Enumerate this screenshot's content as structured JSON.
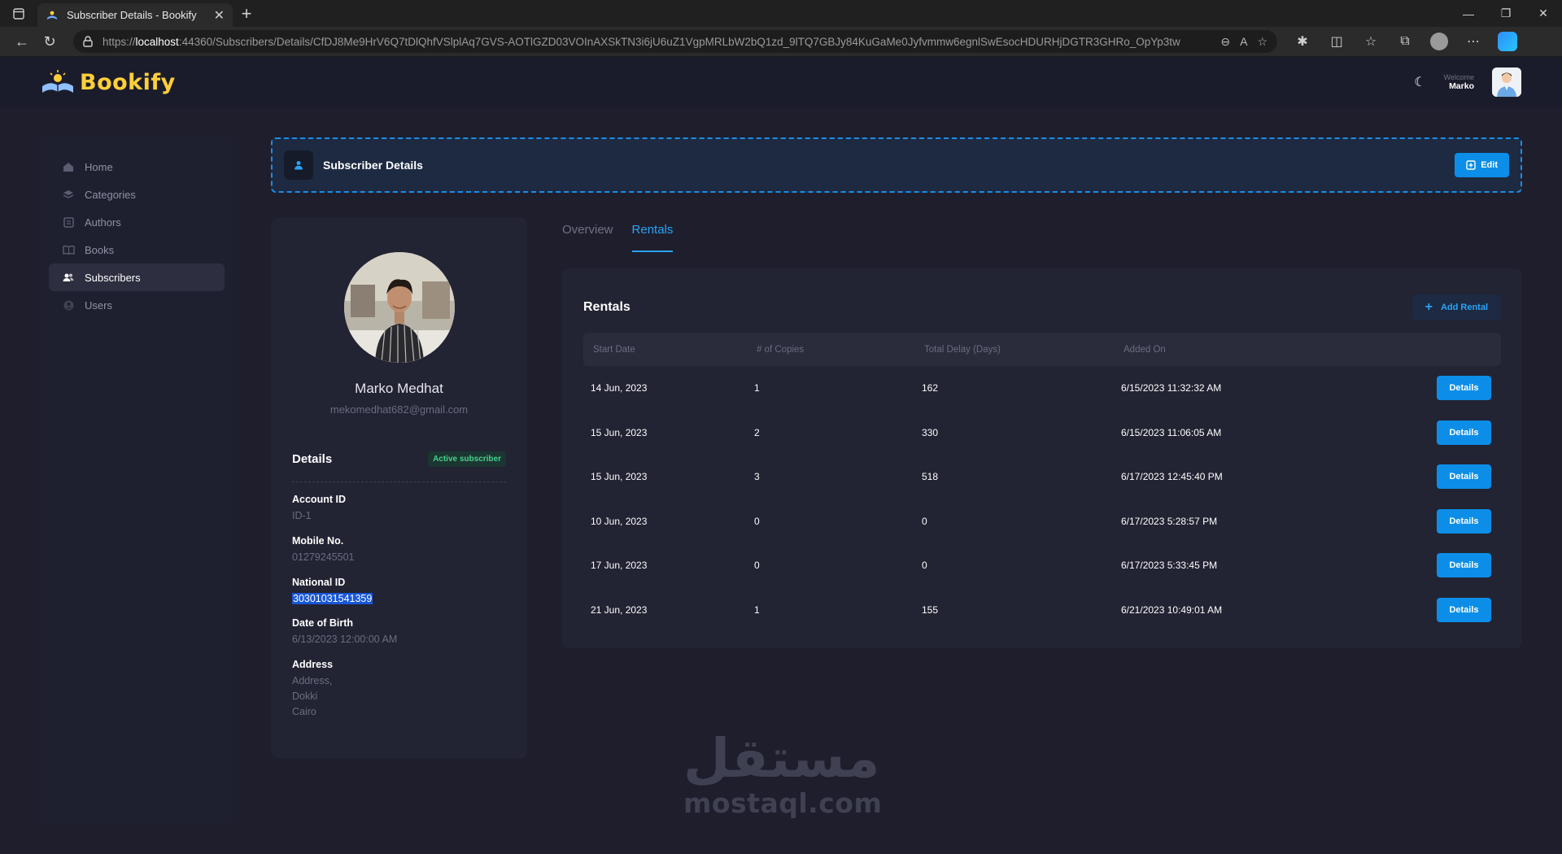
{
  "browser": {
    "tab_title": "Subscriber Details - Bookify",
    "url_prefix": "https://",
    "url_host": "localhost",
    "url_rest": ":44360/Subscribers/Details/CfDJ8Me9HrV6Q7tDlQhfVSlplAq7GVS-AOTlGZD03VOInAXSkTN3i6jU6uZ1VgpMRLbW2bQ1zd_9lTQ7GBJy84KuGaMe0Jyfvmmw6egnlSwEsocHDURHjDGTR3GHRo_OpYp3tw"
  },
  "header": {
    "brand": "Bookify",
    "welcome_label": "Welcome",
    "user_name": "Marko"
  },
  "sidebar": {
    "items": [
      {
        "label": "Home",
        "icon": "home-icon"
      },
      {
        "label": "Categories",
        "icon": "layers-icon"
      },
      {
        "label": "Authors",
        "icon": "authors-icon"
      },
      {
        "label": "Books",
        "icon": "books-icon"
      },
      {
        "label": "Subscribers",
        "icon": "subscribers-icon",
        "active": true
      },
      {
        "label": "Users",
        "icon": "users-icon"
      }
    ]
  },
  "page": {
    "title": "Subscriber Details",
    "edit_label": "Edit"
  },
  "profile": {
    "name": "Marko Medhat",
    "email": "mekomedhat682@gmail.com",
    "details_title": "Details",
    "status_badge": "Active subscriber",
    "fields": {
      "account_id_label": "Account ID",
      "account_id": "ID-1",
      "mobile_label": "Mobile No.",
      "mobile": "01279245501",
      "national_id_label": "National ID",
      "national_id": "30301031541359",
      "dob_label": "Date of Birth",
      "dob": "6/13/2023 12:00:00 AM",
      "address_label": "Address",
      "address_line1": "Address,",
      "address_line2": "Dokki",
      "address_line3": "Cairo"
    }
  },
  "tabs": {
    "overview": "Overview",
    "rentals": "Rentals"
  },
  "rentals": {
    "title": "Rentals",
    "add_label": "Add Rental",
    "columns": [
      "Start Date",
      "# of Copies",
      "Total Delay (Days)",
      "Added On"
    ],
    "action_label": "Details",
    "rows": [
      [
        "14 Jun, 2023",
        "1",
        "162",
        "6/15/2023 11:32:32 AM"
      ],
      [
        "15 Jun, 2023",
        "2",
        "330",
        "6/15/2023 11:06:05 AM"
      ],
      [
        "15 Jun, 2023",
        "3",
        "518",
        "6/17/2023 12:45:40 PM"
      ],
      [
        "10 Jun, 2023",
        "0",
        "0",
        "6/17/2023 5:28:57 PM"
      ],
      [
        "17 Jun, 2023",
        "0",
        "0",
        "6/17/2023 5:33:45 PM"
      ],
      [
        "21 Jun, 2023",
        "1",
        "155",
        "6/21/2023 10:49:01 AM"
      ]
    ]
  },
  "watermark": {
    "arabic": "مستقل",
    "latin": "mostaql.com"
  },
  "colors": {
    "accent": "#0c8ee8",
    "background": "#1e1e2d",
    "card": "#222333",
    "brand_yellow": "#ffcf3a",
    "success": "#49d08d"
  }
}
